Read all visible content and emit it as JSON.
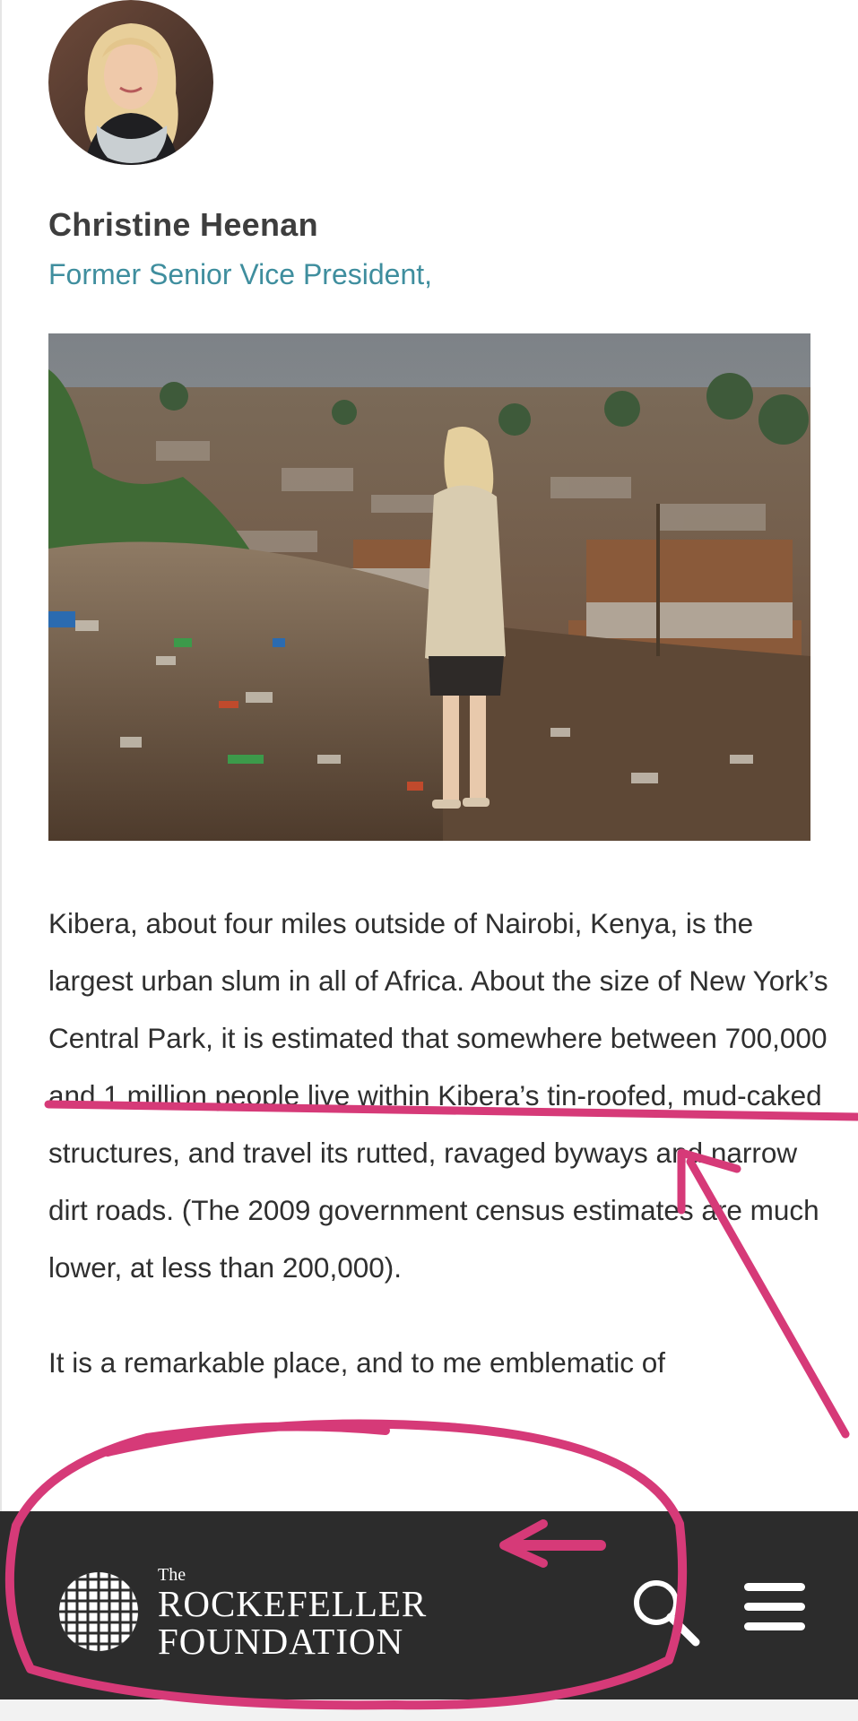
{
  "author": {
    "name": "Christine Heenan",
    "title": "Former Senior Vice President,"
  },
  "article": {
    "paragraph_1": "Kibera, about four miles outside of Nairobi, Kenya, is the largest urban slum in all of Africa. About the size of New York’s Central Park, it is estimated that somewhere between 700,000 and 1 million people live within Kibera’s tin-roofed, mud-caked structures, and travel its rutted, ravaged byways and narrow dirt roads. (The 2009 government census estimates are much lower, at less than 200,000).",
    "paragraph_2": "It is a remarkable place, and to me emblematic of"
  },
  "site_bar": {
    "logo_the": "The",
    "logo_line1": "ROCKEFELLER",
    "logo_line2": "FOUNDATION",
    "search_icon": "search-icon",
    "menu_icon": "hamburger-menu-icon"
  },
  "colors": {
    "author_title": "#3f8e9e",
    "site_bar_bg": "#2c2c2c",
    "annotation": "#d63a78"
  }
}
